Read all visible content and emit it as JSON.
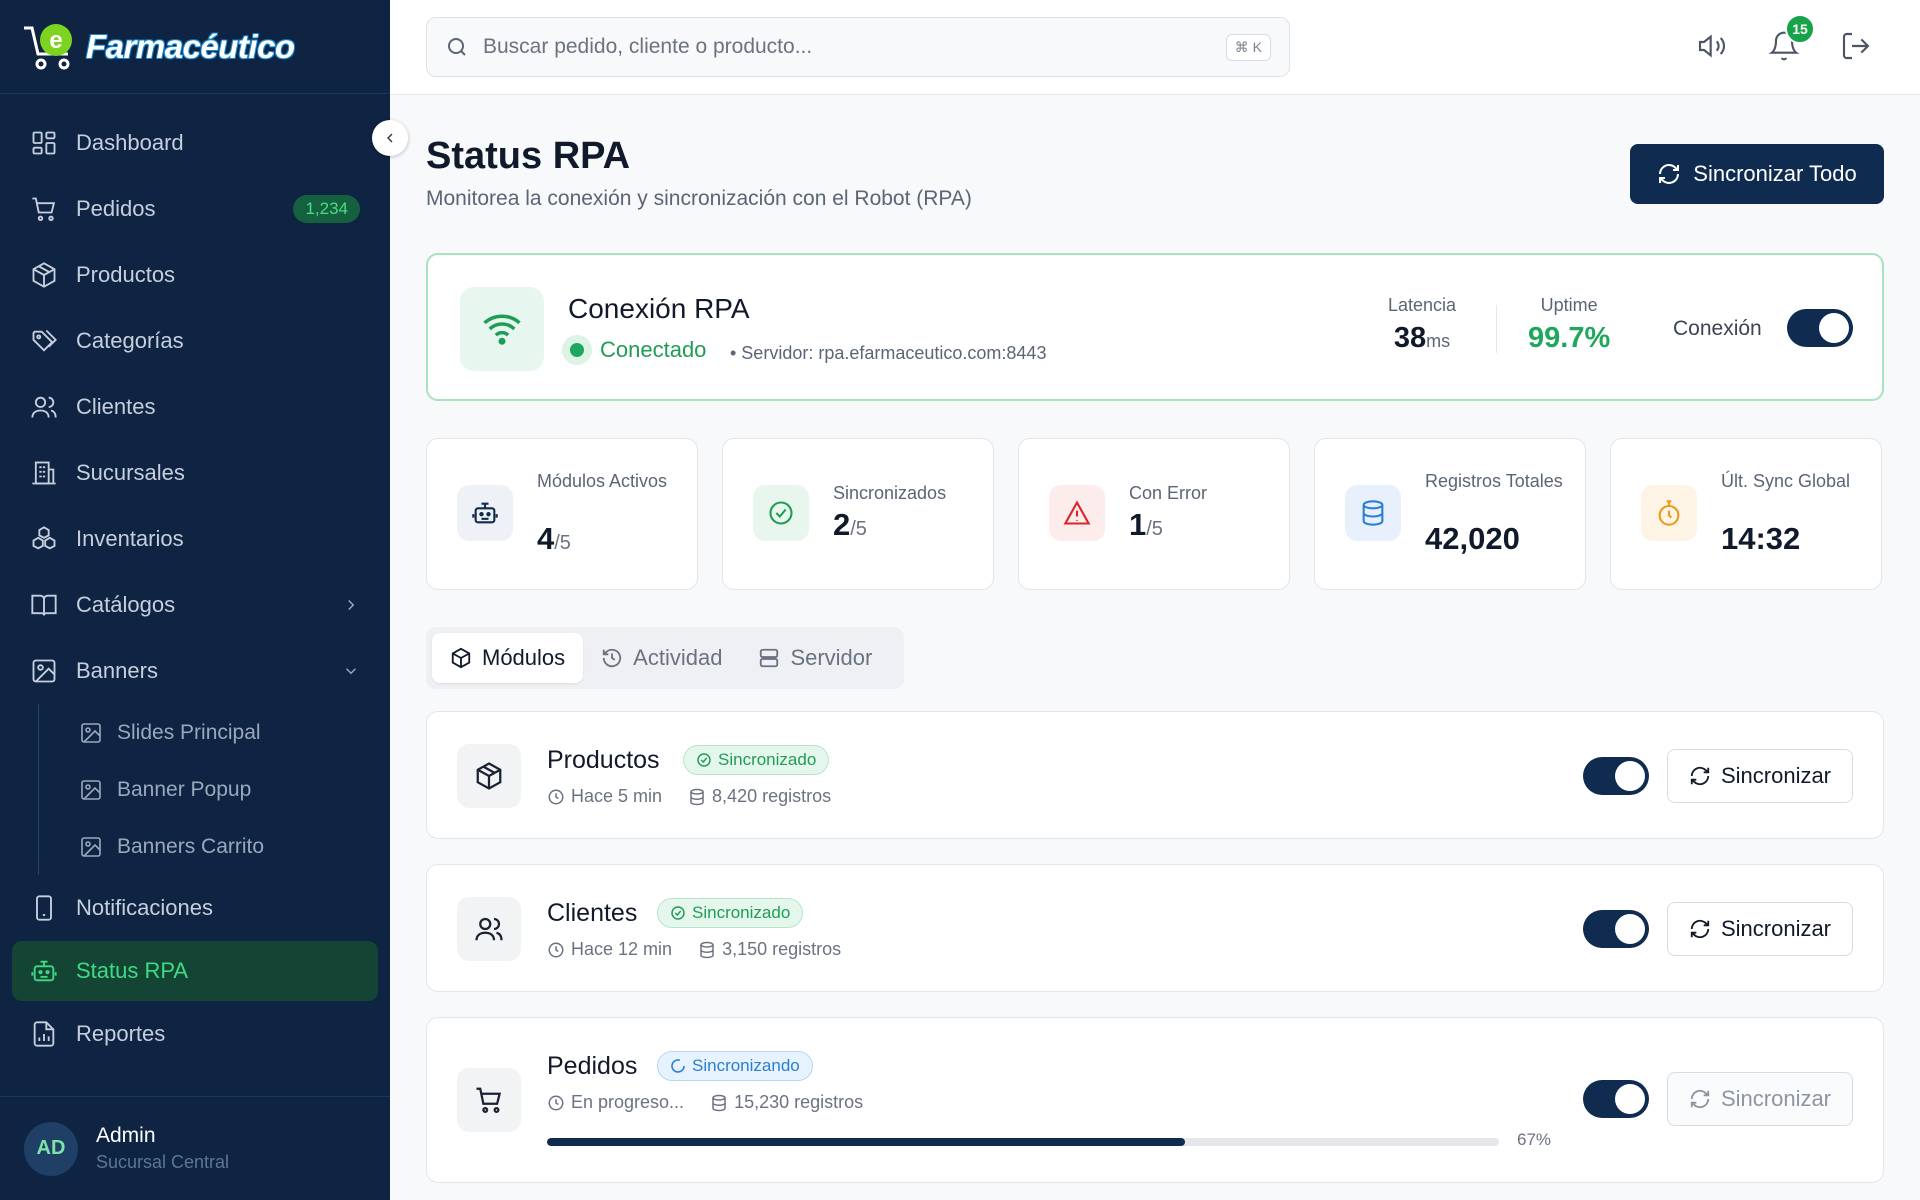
{
  "app": {
    "logo_text": "Farmacéutico"
  },
  "sidebar": {
    "items": [
      {
        "label": "Dashboard",
        "icon": "dashboard-icon"
      },
      {
        "label": "Pedidos",
        "icon": "cart-icon",
        "badge": "1,234"
      },
      {
        "label": "Productos",
        "icon": "box-icon"
      },
      {
        "label": "Categorías",
        "icon": "tag-icon"
      },
      {
        "label": "Clientes",
        "icon": "users-icon"
      },
      {
        "label": "Sucursales",
        "icon": "building-icon"
      },
      {
        "label": "Inventarios",
        "icon": "boxes-icon"
      },
      {
        "label": "Catálogos",
        "icon": "book-icon"
      },
      {
        "label": "Banners",
        "icon": "image-icon"
      }
    ],
    "banner_sub": [
      "Slides Principal",
      "Banner Popup",
      "Banners Carrito"
    ],
    "bottom_items": [
      {
        "label": "Notificaciones",
        "icon": "phone-icon"
      },
      {
        "label": "Status RPA",
        "icon": "robot-icon",
        "active": true
      },
      {
        "label": "Reportes",
        "icon": "report-icon"
      }
    ],
    "user": {
      "initials": "AD",
      "name": "Admin",
      "branch": "Sucursal Central"
    }
  },
  "topbar": {
    "search_placeholder": "Buscar pedido, cliente o producto...",
    "shortcut": "⌘ K",
    "notifications_count": "15"
  },
  "page": {
    "title": "Status RPA",
    "subtitle": "Monitorea la conexión y sincronización con el Robot (RPA)",
    "sync_all_label": "Sincronizar Todo"
  },
  "connection": {
    "title": "Conexión RPA",
    "status": "Conectado",
    "server": "• Servidor: rpa.efarmaceutico.com:8443",
    "latency_label": "Latencia",
    "latency_value": "38",
    "latency_unit": "ms",
    "uptime_label": "Uptime",
    "uptime_value": "99.7%",
    "toggle_label": "Conexión",
    "colors": {
      "ok": "#1f9d55",
      "accent": "#0f2b4f"
    }
  },
  "stats": [
    {
      "label": "Módulos Activos",
      "value": "4",
      "total": "/5",
      "icon": "robot-icon"
    },
    {
      "label": "Sincronizados",
      "value": "2",
      "total": "/5",
      "icon": "check-circle-icon"
    },
    {
      "label": "Con Error",
      "value": "1",
      "total": "/5",
      "icon": "warning-icon"
    },
    {
      "label": "Registros Totales",
      "value": "42,020",
      "total": "",
      "icon": "database-icon"
    },
    {
      "label": "Últ. Sync Global",
      "value": "14:32",
      "total": "",
      "icon": "timer-icon"
    }
  ],
  "tabs": [
    "Módulos",
    "Actividad",
    "Servidor"
  ],
  "modules": [
    {
      "name": "Productos",
      "status": "Sincronizado",
      "time": "Hace 5 min",
      "records": "8,420 registros",
      "button": "Sincronizar"
    },
    {
      "name": "Clientes",
      "status": "Sincronizado",
      "time": "Hace 12 min",
      "records": "3,150 registros",
      "button": "Sincronizar"
    },
    {
      "name": "Pedidos",
      "status": "Sincronizando",
      "time": "En progreso...",
      "records": "15,230 registros",
      "button": "Sincronizar",
      "progress": 67,
      "progress_label": "67%"
    }
  ]
}
